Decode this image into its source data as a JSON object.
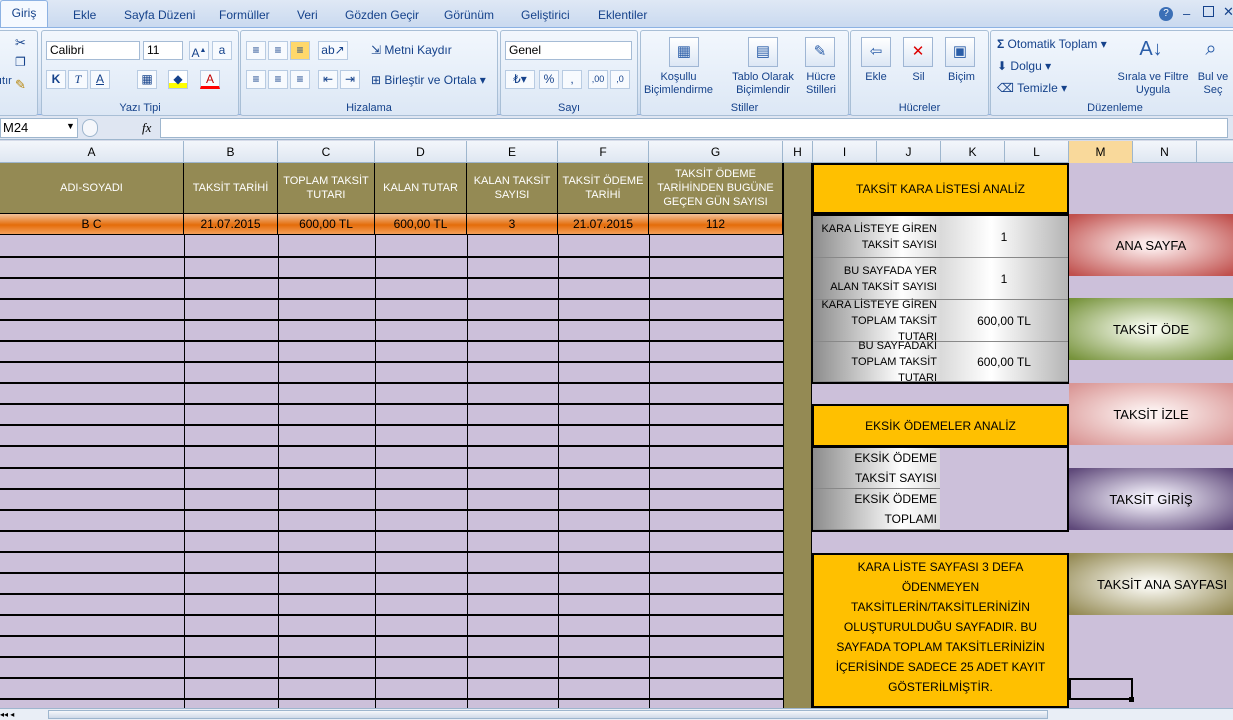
{
  "tabs": [
    "Giriş",
    "Ekle",
    "Sayfa Düzeni",
    "Formüller",
    "Veri",
    "Gözden Geçir",
    "Görünüm",
    "Geliştirici",
    "Eklentiler"
  ],
  "ribbon": {
    "clipboard_label": "ıtır",
    "font_name": "Calibri",
    "font_size": "11",
    "yazi_tipi": "Yazı Tipi",
    "hizalama": "Hizalama",
    "metni_kaydir": "Metni Kaydır",
    "birlestir": "Birleştir ve Ortala",
    "number_format": "Genel",
    "sayi": "Sayı",
    "kosullu_1": "Koşullu",
    "kosullu_2": "Biçimlendirme",
    "tablo_1": "Tablo Olarak",
    "tablo_2": "Biçimlendir",
    "hucre_st_1": "Hücre",
    "hucre_st_2": "Stilleri",
    "stiller": "Stiller",
    "ekle": "Ekle",
    "sil": "Sil",
    "bicim": "Biçim",
    "hucreler": "Hücreler",
    "otomatik_toplam": "Otomatik Toplam",
    "dolgu": "Dolgu",
    "temizle": "Temizle",
    "sirala_1": "Sırala ve Filtre",
    "sirala_2": "Uygula",
    "bul_1": "Bul ve",
    "bul_2": "Seç",
    "duzenleme": "Düzenleme"
  },
  "namebox": "M24",
  "fx": "fx",
  "columns": [
    "A",
    "B",
    "C",
    "D",
    "E",
    "F",
    "G",
    "H",
    "I",
    "J",
    "K",
    "L",
    "M",
    "N"
  ],
  "table": {
    "headers": {
      "a": "ADI-SOYADI",
      "b": "TAKSİT TARİHİ",
      "c": "TOPLAM TAKSİT TUTARI",
      "d": "KALAN TUTAR",
      "e": "KALAN TAKSİT SAYISI",
      "f": "TAKSİT ÖDEME TARİHİ",
      "g": "TAKSİT ÖDEME TARİHİNDEN BUGÜNE GEÇEN GÜN SAYISI"
    },
    "row1": {
      "a": "B C",
      "b": "21.07.2015",
      "c": "600,00 TL",
      "d": "600,00 TL",
      "e": "3",
      "f": "21.07.2015",
      "g": "112"
    }
  },
  "analysis": {
    "kara_title": "TAKSİT KARA LİSTESİ ANALİZ",
    "stats": [
      {
        "label": "KARA LİSTEYE GİREN TAKSİT SAYISI",
        "value": "1"
      },
      {
        "label": "BU SAYFADA YER ALAN TAKSİT SAYISI",
        "value": "1"
      },
      {
        "label": "KARA LİSTEYE GİREN TOPLAM TAKSİT TUTARI",
        "value": "600,00 TL"
      },
      {
        "label": "BU SAYFADAKİ TOPLAM TAKSİT TUTARI",
        "value": "600,00 TL"
      }
    ],
    "eksik_title": "EKSİK ÖDEMELER ANALİZ",
    "eksik_stats": [
      {
        "label": "EKSİK ÖDEME TAKSİT SAYISI",
        "value": ""
      },
      {
        "label": "EKSİK ÖDEME TOPLAMI",
        "value": ""
      }
    ],
    "note": "KARA LİSTE SAYFASI 3 DEFA ÖDENMEYEN TAKSİTLERİN/TAKSİTLERİNİZİN OLUŞTURULDUĞU SAYFADIR. BU SAYFADA TOPLAM TAKSİTLERİNİZİN İÇERİSİNDE SADECE 25 ADET KAYIT GÖSTERİLMİŞTİR."
  },
  "nav_buttons": {
    "ana_sayfa": "ANA SAYFA",
    "taksit_ode": "TAKSİT ÖDE",
    "taksit_izle": "TAKSİT İZLE",
    "taksit_giris": "TAKSİT GİRİŞ",
    "taksit_ana_sayfasi": "TAKSİT ANA SAYFASI"
  },
  "colors": {
    "header_olive": "#948a54",
    "grid_lavender": "#ccc0da",
    "accent_yellow": "#ffc000",
    "row_orange": "#e46c0a"
  }
}
